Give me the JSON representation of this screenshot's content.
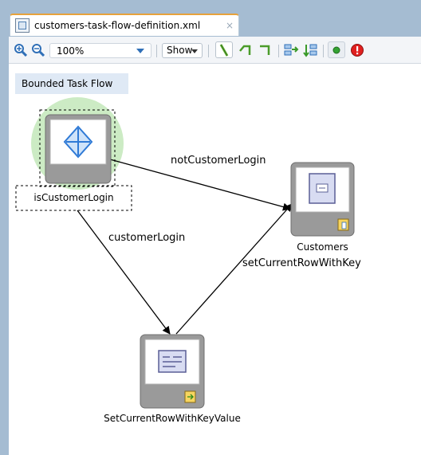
{
  "editor": {
    "tab_label": "customers-task-flow-definition.xml",
    "tab_close": "×"
  },
  "toolbar": {
    "zoom_value": "100%",
    "show_label": "Show"
  },
  "diagram": {
    "title": "Bounded Task Flow",
    "nodes": {
      "router": "isCustomerLogin",
      "view": "Customers",
      "method": "SetCurrentRowWithKeyValue"
    },
    "edges": {
      "not_customer": "notCustomerLogin",
      "customer": "customerLogin",
      "set_row": "setCurrentRowWithKey"
    }
  },
  "colors": {
    "frame": "#a5bcd2",
    "tab_accent": "#e7a23b",
    "default_activity_halo": "#ccebc4",
    "router_icon": "#2f7ad6"
  }
}
